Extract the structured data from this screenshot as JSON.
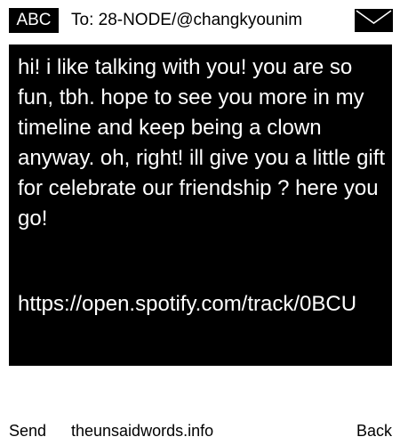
{
  "header": {
    "input_mode": "ABC",
    "recipient": "To: 28-NODE/@changkyounim",
    "envelope_icon": "envelope-icon"
  },
  "message": {
    "body": "hi! i like talking with you! you are so fun, tbh. hope to see you more in my timeline and keep being a clown anyway. oh, right! ill give you a little gift for celebrate our friendship ? here you go!",
    "link": "https://open.spotify.com/track/0BCU"
  },
  "footer": {
    "send_label": "Send",
    "site_label": "theunsaidwords.info",
    "back_label": "Back"
  },
  "colors": {
    "background": "#ffffff",
    "message_bg": "#000000",
    "text": "#000000",
    "message_text": "#ffffff"
  }
}
